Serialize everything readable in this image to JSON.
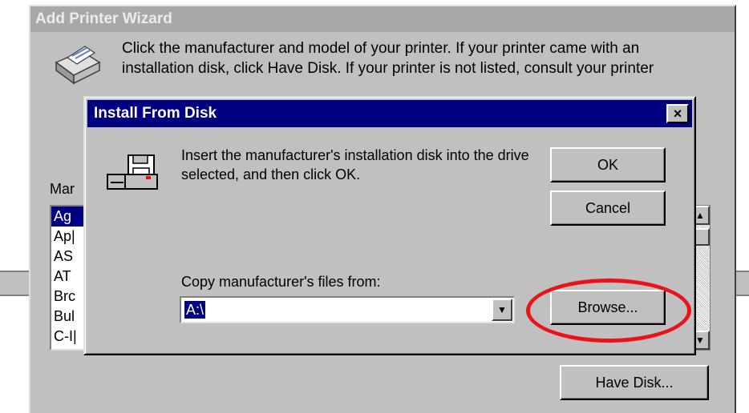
{
  "wizard": {
    "title": "Add Printer Wizard",
    "instruction_line1": "Click the manufacturer and model of your printer. If your printer came with an",
    "instruction_line2": "installation disk, click Have Disk. If your printer is not listed, consult your printer",
    "manufacturers_label": "Mar",
    "manufacturers": [
      "Ag",
      "Ap|",
      "AS",
      "AT",
      "Brc",
      "Bul",
      "C-I|"
    ],
    "have_disk_label": "Have Disk..."
  },
  "dialog": {
    "title": "Install From Disk",
    "close_label": "×",
    "message": "Insert the manufacturer's installation disk into the drive selected, and then click OK.",
    "ok_label": "OK",
    "cancel_label": "Cancel",
    "copy_label": "Copy manufacturer's files from:",
    "path_value": "A:\\",
    "browse_label": "Browse..."
  },
  "annotation": {
    "color": "#e8141a"
  }
}
